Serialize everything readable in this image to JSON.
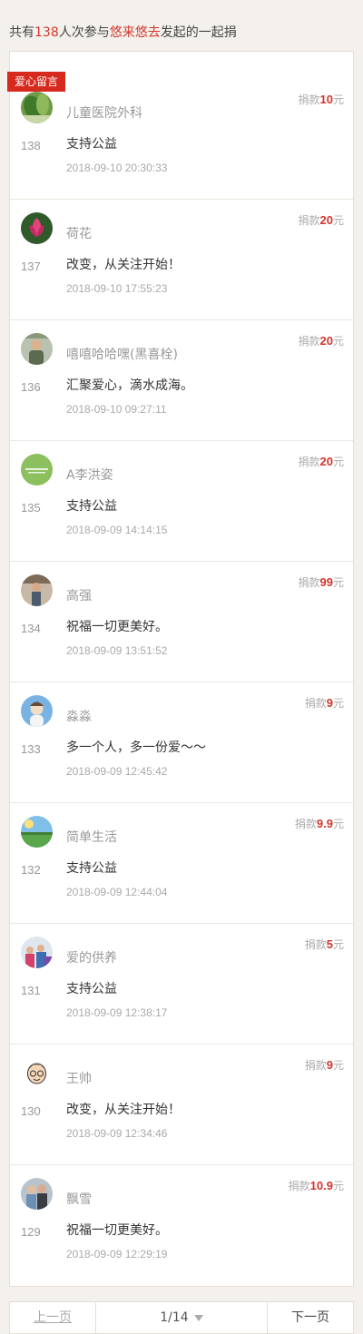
{
  "header": {
    "prefix": "共有",
    "count": "138",
    "middle": "人次参与",
    "organizer": "悠来悠去",
    "suffix": "发起的一起捐"
  },
  "section_tag": "爱心留言",
  "amount_prefix": "捐款",
  "amount_suffix": "元",
  "entries": [
    {
      "seq": "138",
      "name": "儿童医院外科",
      "message": "支持公益",
      "time": "2018-09-10 20:30:33",
      "amount": "10",
      "avatar_icon": "leaf-avatar-icon"
    },
    {
      "seq": "137",
      "name": "荷花",
      "message": "改变，从关注开始！",
      "time": "2018-09-10 17:55:23",
      "amount": "20",
      "avatar_icon": "lotus-avatar-icon"
    },
    {
      "seq": "136",
      "name": "嘻嘻哈哈嘿(黑喜栓)",
      "message": "汇聚爱心，滴水成海。",
      "time": "2018-09-10 09:27:11",
      "amount": "20",
      "avatar_icon": "person-avatar-icon"
    },
    {
      "seq": "135",
      "name": "A李洪姿",
      "message": "支持公益",
      "time": "2018-09-09 14:14:15",
      "amount": "20",
      "avatar_icon": "green-logo-avatar-icon"
    },
    {
      "seq": "134",
      "name": "高强",
      "message": "祝福一切更美好。",
      "time": "2018-09-09 13:51:52",
      "amount": "99",
      "avatar_icon": "person-avatar-icon"
    },
    {
      "seq": "133",
      "name": "淼淼",
      "message": "多一个人，多一份爱～～",
      "time": "2018-09-09 12:45:42",
      "amount": "9",
      "avatar_icon": "child-avatar-icon"
    },
    {
      "seq": "132",
      "name": "简单生活",
      "message": "支持公益",
      "time": "2018-09-09 12:44:04",
      "amount": "9.9",
      "avatar_icon": "landscape-avatar-icon"
    },
    {
      "seq": "131",
      "name": "爱的供养",
      "message": "支持公益",
      "time": "2018-09-09 12:38:17",
      "amount": "5",
      "avatar_icon": "group-avatar-icon"
    },
    {
      "seq": "130",
      "name": "王帅",
      "message": "改变，从关注开始！",
      "time": "2018-09-09 12:34:46",
      "amount": "9",
      "avatar_icon": "cartoon-face-avatar-icon"
    },
    {
      "seq": "129",
      "name": "飘雪",
      "message": "祝福一切更美好。",
      "time": "2018-09-09 12:29:19",
      "amount": "10.9",
      "avatar_icon": "couple-avatar-icon"
    }
  ],
  "pager": {
    "prev": "上一页",
    "page": "1/14",
    "next": "下一页"
  }
}
